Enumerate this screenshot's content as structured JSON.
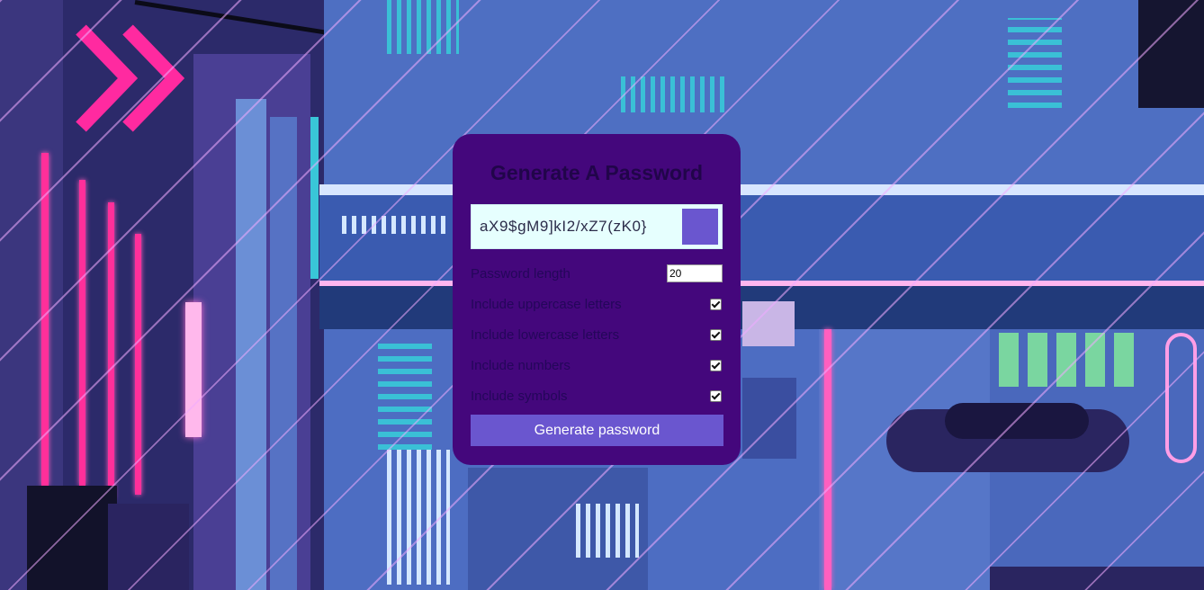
{
  "card": {
    "title": "Generate A Password",
    "result": "aX9$gM9]kI2/xZ7(zK0}",
    "copy_icon": "clipboard-icon",
    "length_label": "Password length",
    "length_value": "20",
    "options": [
      {
        "label": "Include uppercase letters",
        "checked": true
      },
      {
        "label": "Include lowercase letters",
        "checked": true
      },
      {
        "label": "Include numbers",
        "checked": true
      },
      {
        "label": "Include symbols",
        "checked": true
      }
    ],
    "generate_label": "Generate password"
  },
  "colors": {
    "card_bg": "#44077c",
    "accent": "#6a56cf",
    "result_bg": "#e6fffe",
    "title": "#21054a"
  }
}
